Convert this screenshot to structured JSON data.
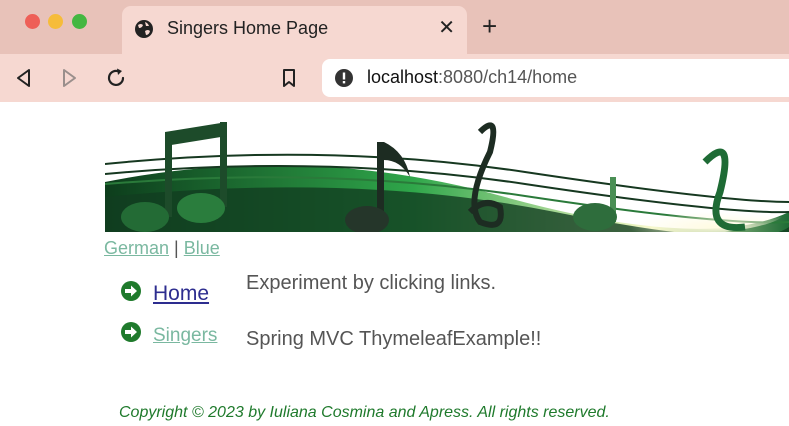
{
  "browser": {
    "tab": {
      "title": "Singers Home Page"
    },
    "url": {
      "host": "localhost",
      "rest": ":8080/ch14/home"
    }
  },
  "theme_links": {
    "german": "German",
    "separator": "|",
    "blue": "Blue"
  },
  "nav": {
    "items": [
      {
        "label": "Home"
      },
      {
        "label": "Singers"
      }
    ]
  },
  "content": {
    "line1": "Experiment by clicking links.",
    "line2": "Spring MVC ThymeleafExample!!"
  },
  "footer": {
    "text": "Copyright © 2023 by Iuliana Cosmina and Apress. All rights reserved."
  },
  "colors": {
    "tabstrip": "#e8c2b9",
    "toolbar": "#f6d8d1",
    "link_visited": "#7ab8a0",
    "link": "#2d2d8f",
    "footer": "#1f7a2c",
    "nav_icon": "#1f7a2c"
  },
  "icons": {
    "window_controls": [
      "close-dot",
      "minimize-dot",
      "maximize-dot"
    ],
    "tab": "globe-icon",
    "toolbar": [
      "back-icon",
      "forward-icon",
      "reload-icon",
      "bookmark-icon",
      "info-icon"
    ],
    "nav": "arrow-circle-icon"
  }
}
